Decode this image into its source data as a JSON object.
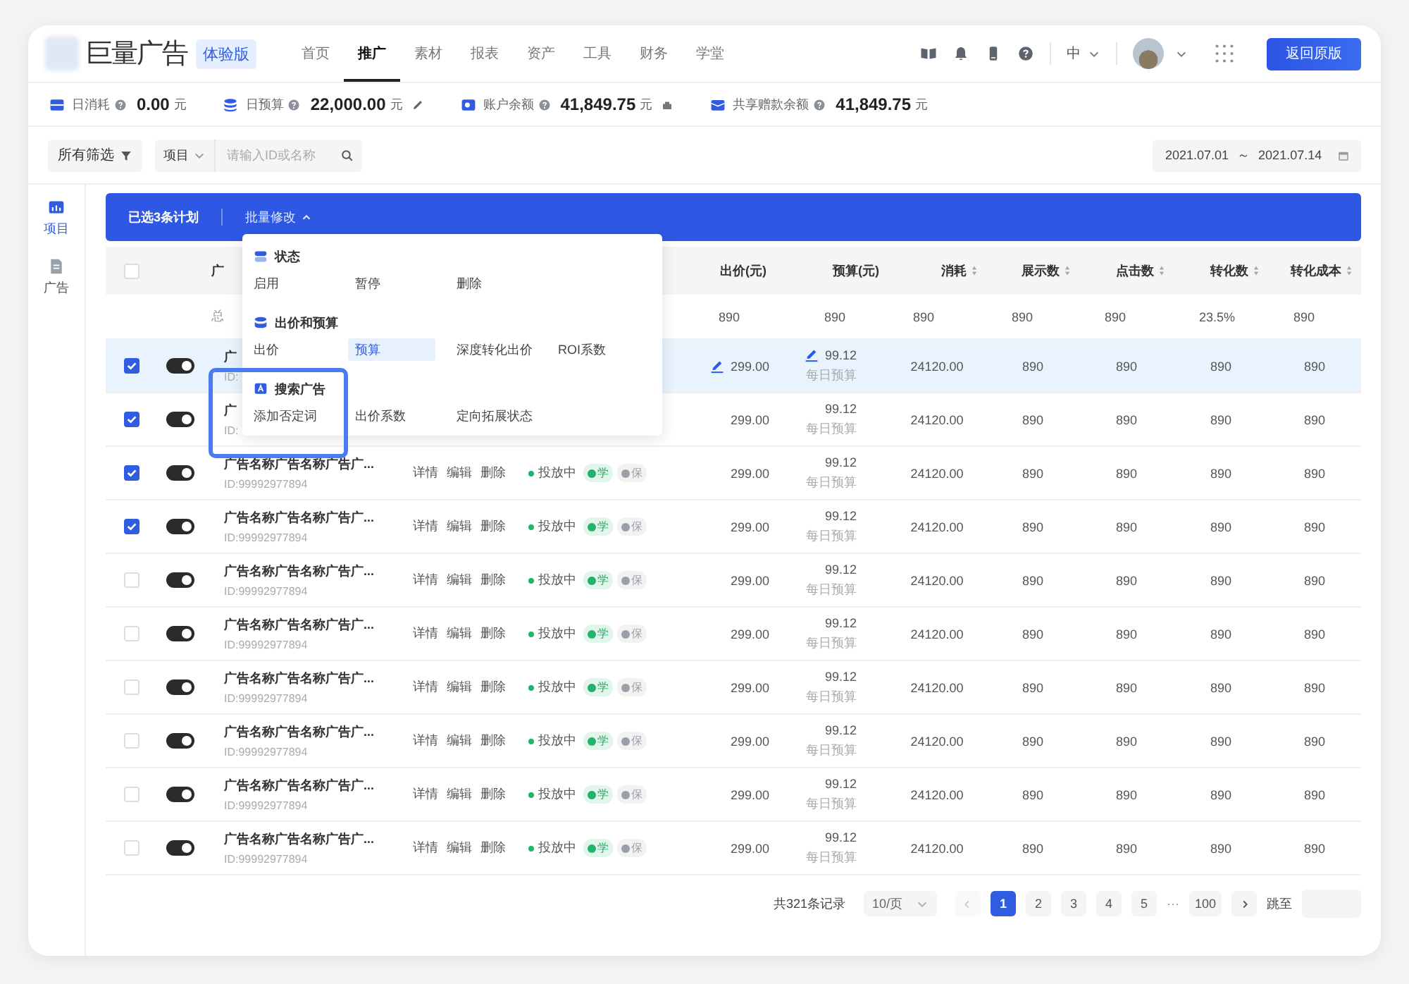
{
  "header": {
    "brand": "巨量广告",
    "badge": "体验版",
    "nav": [
      {
        "label": "首页",
        "selected": false
      },
      {
        "label": "推广",
        "selected": true
      },
      {
        "label": "素材",
        "selected": false
      },
      {
        "label": "报表",
        "selected": false
      },
      {
        "label": "资产",
        "selected": false
      },
      {
        "label": "工具",
        "selected": false
      },
      {
        "label": "财务",
        "selected": false
      },
      {
        "label": "学堂",
        "selected": false
      }
    ],
    "language": "中",
    "action_button": "返回原版"
  },
  "stats": [
    {
      "kind": "spend",
      "label": "日消耗",
      "value": "0.00",
      "unit": "元"
    },
    {
      "kind": "budget",
      "label": "日预算",
      "value": "22,000.00",
      "unit": "元"
    },
    {
      "kind": "balance",
      "label": "账户余额",
      "value": "41,849.75",
      "unit": "元"
    },
    {
      "kind": "shared",
      "label": "共享赠款余额",
      "value": "41,849.75",
      "unit": "元"
    }
  ],
  "filters": {
    "all_filter": "所有筛选",
    "scope": "项目",
    "search": {
      "placeholder": "请输入ID或名称"
    },
    "date_start": "2021.07.01",
    "date_separator": "～",
    "date_end": "2021.07.14"
  },
  "sidebar": [
    {
      "label": "项目",
      "selected": true
    },
    {
      "label": "广告",
      "selected": false
    }
  ],
  "batch_bar": {
    "selected_text": "已选3条计划",
    "action": "批量修改",
    "expanded": true
  },
  "menu": {
    "sections": [
      {
        "kind": "status",
        "title": "状态",
        "items": [
          {
            "label": "启用",
            "selected": false
          },
          {
            "label": "暂停",
            "selected": false
          },
          {
            "label": "删除",
            "selected": false
          }
        ]
      },
      {
        "kind": "bid",
        "title": "出价和预算",
        "items": [
          {
            "label": "出价",
            "selected": false
          },
          {
            "label": "预算",
            "selected": true
          },
          {
            "label": "深度转化出价",
            "selected": false
          },
          {
            "label": "ROI系数",
            "selected": false
          }
        ]
      },
      {
        "kind": "search",
        "title": "搜索广告",
        "items": [
          {
            "label": "添加否定词",
            "selected": false
          },
          {
            "label": "出价系数",
            "selected": false
          },
          {
            "label": "定向拓展状态",
            "selected": false
          }
        ]
      }
    ]
  },
  "table": {
    "header_checked": false,
    "name_column": "广",
    "columns": [
      {
        "label": "出价(元)",
        "sortable": false
      },
      {
        "label": "预算(元)",
        "sortable": false
      },
      {
        "label": "消耗",
        "sortable": true
      },
      {
        "label": "展示数",
        "sortable": true
      },
      {
        "label": "点击数",
        "sortable": true
      },
      {
        "label": "转化数",
        "sortable": true
      },
      {
        "label": "转化成本",
        "sortable": true
      }
    ],
    "summary": {
      "label": "总",
      "values": [
        "890",
        "890",
        "890",
        "890",
        "890",
        "23.5%",
        "890"
      ]
    },
    "rows": [
      {
        "selected": true,
        "checked": true,
        "on": true,
        "name": "广",
        "id": "ID:",
        "price": "299.00",
        "price_editable": true,
        "budget": "99.12",
        "budget_editable": true,
        "budget_note": "每日预算",
        "metrics": [
          "24120.00",
          "890",
          "890",
          "890",
          "890"
        ]
      },
      {
        "selected": false,
        "checked": true,
        "on": true,
        "name": "广",
        "id": "ID:",
        "price": "299.00",
        "price_editable": false,
        "budget": "99.12",
        "budget_editable": false,
        "budget_note": "每日预算",
        "metrics": [
          "24120.00",
          "890",
          "890",
          "890",
          "890"
        ]
      },
      {
        "selected": false,
        "checked": true,
        "on": true,
        "name": "广告名称广告名称广告广...",
        "id": "ID:99992977894",
        "actions": [
          "详情",
          "编辑",
          "删除"
        ],
        "status": "投放中",
        "tags": [
          {
            "label": "学",
            "color": "#21b36b"
          },
          {
            "label": "保",
            "color": "#9aa0a8"
          }
        ],
        "price": "299.00",
        "price_editable": false,
        "budget": "99.12",
        "budget_editable": false,
        "budget_note": "每日预算",
        "metrics": [
          "24120.00",
          "890",
          "890",
          "890",
          "890"
        ]
      },
      {
        "selected": false,
        "checked": true,
        "on": true,
        "name": "广告名称广告名称广告广...",
        "id": "ID:99992977894",
        "actions": [
          "详情",
          "编辑",
          "删除"
        ],
        "status": "投放中",
        "tags": [
          {
            "label": "学",
            "color": "#21b36b"
          },
          {
            "label": "保",
            "color": "#9aa0a8"
          }
        ],
        "price": "299.00",
        "price_editable": false,
        "budget": "99.12",
        "budget_editable": false,
        "budget_note": "每日预算",
        "metrics": [
          "24120.00",
          "890",
          "890",
          "890",
          "890"
        ]
      },
      {
        "selected": false,
        "checked": false,
        "on": true,
        "name": "广告名称广告名称广告广...",
        "id": "ID:99992977894",
        "actions": [
          "详情",
          "编辑",
          "删除"
        ],
        "status": "投放中",
        "tags": [
          {
            "label": "学",
            "color": "#21b36b"
          },
          {
            "label": "保",
            "color": "#9aa0a8"
          }
        ],
        "price": "299.00",
        "price_editable": false,
        "budget": "99.12",
        "budget_editable": false,
        "budget_note": "每日预算",
        "metrics": [
          "24120.00",
          "890",
          "890",
          "890",
          "890"
        ]
      },
      {
        "selected": false,
        "checked": false,
        "on": true,
        "name": "广告名称广告名称广告广...",
        "id": "ID:99992977894",
        "actions": [
          "详情",
          "编辑",
          "删除"
        ],
        "status": "投放中",
        "tags": [
          {
            "label": "学",
            "color": "#21b36b"
          },
          {
            "label": "保",
            "color": "#9aa0a8"
          }
        ],
        "price": "299.00",
        "price_editable": false,
        "budget": "99.12",
        "budget_editable": false,
        "budget_note": "每日预算",
        "metrics": [
          "24120.00",
          "890",
          "890",
          "890",
          "890"
        ]
      },
      {
        "selected": false,
        "checked": false,
        "on": true,
        "name": "广告名称广告名称广告广...",
        "id": "ID:99992977894",
        "actions": [
          "详情",
          "编辑",
          "删除"
        ],
        "status": "投放中",
        "tags": [
          {
            "label": "学",
            "color": "#21b36b"
          },
          {
            "label": "保",
            "color": "#9aa0a8"
          }
        ],
        "price": "299.00",
        "price_editable": false,
        "budget": "99.12",
        "budget_editable": false,
        "budget_note": "每日预算",
        "metrics": [
          "24120.00",
          "890",
          "890",
          "890",
          "890"
        ]
      },
      {
        "selected": false,
        "checked": false,
        "on": true,
        "name": "广告名称广告名称广告广...",
        "id": "ID:99992977894",
        "actions": [
          "详情",
          "编辑",
          "删除"
        ],
        "status": "投放中",
        "tags": [
          {
            "label": "学",
            "color": "#21b36b"
          },
          {
            "label": "保",
            "color": "#9aa0a8"
          }
        ],
        "price": "299.00",
        "price_editable": false,
        "budget": "99.12",
        "budget_editable": false,
        "budget_note": "每日预算",
        "metrics": [
          "24120.00",
          "890",
          "890",
          "890",
          "890"
        ]
      },
      {
        "selected": false,
        "checked": false,
        "on": true,
        "name": "广告名称广告名称广告广...",
        "id": "ID:99992977894",
        "actions": [
          "详情",
          "编辑",
          "删除"
        ],
        "status": "投放中",
        "tags": [
          {
            "label": "学",
            "color": "#21b36b"
          },
          {
            "label": "保",
            "color": "#9aa0a8"
          }
        ],
        "price": "299.00",
        "price_editable": false,
        "budget": "99.12",
        "budget_editable": false,
        "budget_note": "每日预算",
        "metrics": [
          "24120.00",
          "890",
          "890",
          "890",
          "890"
        ]
      },
      {
        "selected": false,
        "checked": false,
        "on": true,
        "name": "广告名称广告名称广告广...",
        "id": "ID:99992977894",
        "actions": [
          "详情",
          "编辑",
          "删除"
        ],
        "status": "投放中",
        "tags": [
          {
            "label": "学",
            "color": "#21b36b"
          },
          {
            "label": "保",
            "color": "#9aa0a8"
          }
        ],
        "price": "299.00",
        "price_editable": false,
        "budget": "99.12",
        "budget_editable": false,
        "budget_note": "每日预算",
        "metrics": [
          "24120.00",
          "890",
          "890",
          "890",
          "890"
        ]
      }
    ]
  },
  "pagination": {
    "total": "共321条记录",
    "page_size": "10/页",
    "pages": [
      {
        "label": "1",
        "selected": true
      },
      {
        "label": "2",
        "selected": false
      },
      {
        "label": "3",
        "selected": false
      },
      {
        "label": "4",
        "selected": false
      },
      {
        "label": "5",
        "selected": false
      },
      {
        "label": "···",
        "selected": false,
        "kind": "ellipsis"
      },
      {
        "label": "100",
        "selected": false
      }
    ],
    "prev_disabled": true,
    "jump_label": "跳至"
  }
}
